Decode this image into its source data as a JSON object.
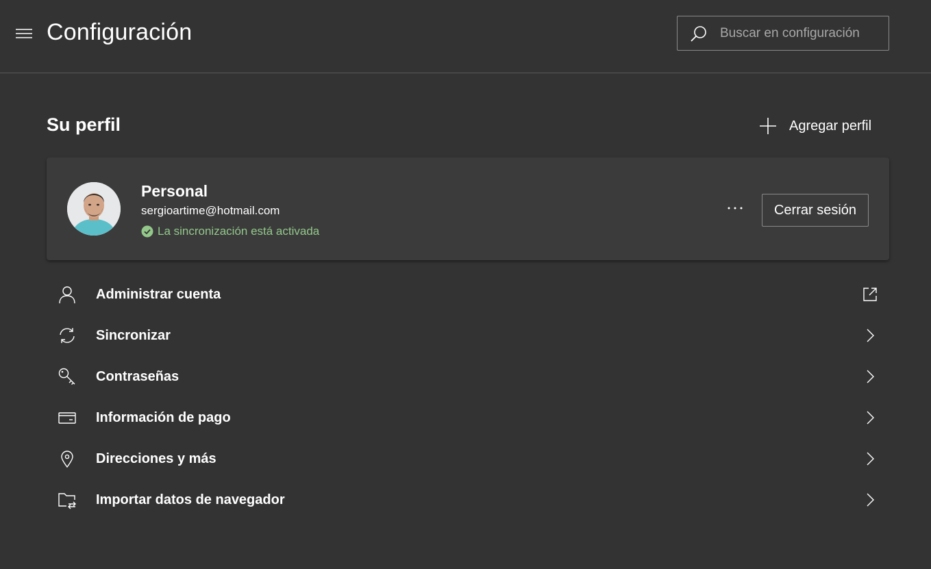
{
  "header": {
    "title": "Configuración",
    "menu_icon": "hamburger-icon",
    "search": {
      "placeholder": "Buscar en configuración",
      "value": "",
      "icon": "search-icon"
    }
  },
  "profile_section": {
    "title": "Su perfil",
    "add_profile_label": "Agregar perfil",
    "card": {
      "name": "Personal",
      "email": "sergioartime@hotmail.com",
      "sync_status": "La sincronización está activada",
      "more_label": "···",
      "sign_out_label": "Cerrar sesión"
    }
  },
  "menu": {
    "items": [
      {
        "label": "Administrar cuenta",
        "icon": "person-icon",
        "trailing": "external-link-icon"
      },
      {
        "label": "Sincronizar",
        "icon": "sync-icon",
        "trailing": "chevron-right-icon"
      },
      {
        "label": "Contraseñas",
        "icon": "key-icon",
        "trailing": "chevron-right-icon"
      },
      {
        "label": "Información de pago",
        "icon": "credit-card-icon",
        "trailing": "chevron-right-icon"
      },
      {
        "label": "Direcciones y más",
        "icon": "location-pin-icon",
        "trailing": "chevron-right-icon"
      },
      {
        "label": "Importar datos de navegador",
        "icon": "import-folder-icon",
        "trailing": "chevron-right-icon"
      }
    ]
  },
  "colors": {
    "background": "#333333",
    "card": "#3b3b3b",
    "sync_green": "#93c88a",
    "text": "#ffffff"
  }
}
